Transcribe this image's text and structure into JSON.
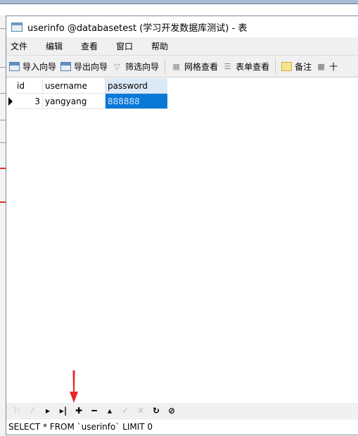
{
  "window": {
    "title": "userinfo @databasetest (学习开发数据库测试) - 表"
  },
  "menu": [
    "文件",
    "编辑",
    "查看",
    "窗口",
    "帮助"
  ],
  "toolbar": {
    "import": "导入向导",
    "export": "导出向导",
    "filter": "筛选向导",
    "grid_view": "网格查看",
    "form_view": "表单查看",
    "memo": "备注",
    "more": "十"
  },
  "table": {
    "columns": [
      "id",
      "username",
      "password"
    ],
    "rows": [
      {
        "id": "3",
        "username": "yangyang",
        "password": "888888"
      }
    ]
  },
  "nav": {
    "icons": [
      "first-icon",
      "prev-icon",
      "next-icon",
      "last-icon",
      "add-icon",
      "delete-icon",
      "up-icon",
      "apply-icon",
      "cancel-icon",
      "refresh-icon",
      "stop-icon"
    ]
  },
  "status": {
    "sql": "SELECT * FROM `userinfo` LIMIT 0"
  },
  "colors": {
    "selection": "#0a78d7",
    "annotation_arrow": "#e8282d"
  }
}
